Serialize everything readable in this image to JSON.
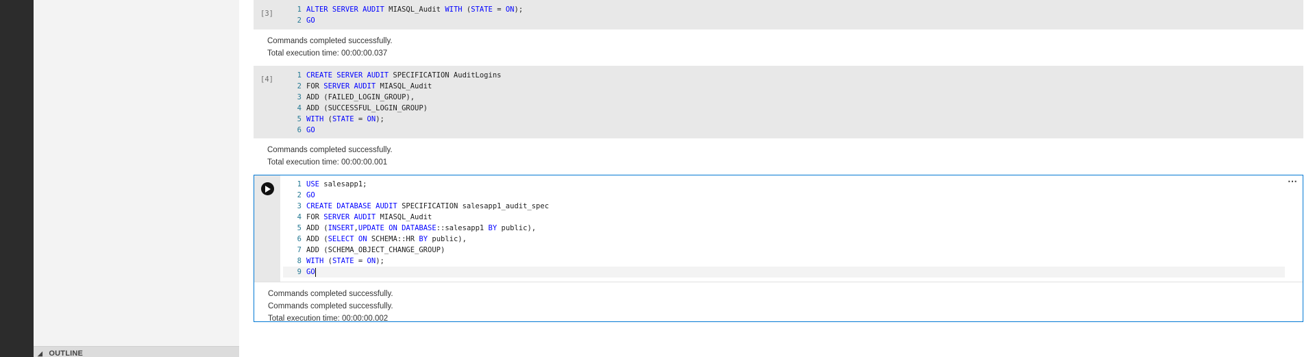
{
  "outline": {
    "label": "OUTLINE"
  },
  "cells": {
    "c3": {
      "exec_count": "[3]",
      "lines": [
        [
          {
            "t": "ALTER SERVER AUDIT",
            "k": true
          },
          {
            "t": " MIASQL_Audit ",
            "k": false
          },
          {
            "t": "WITH",
            "k": true
          },
          {
            "t": " (",
            "k": false
          },
          {
            "t": "STATE",
            "k": true
          },
          {
            "t": " = ",
            "k": false
          },
          {
            "t": "ON",
            "k": true
          },
          {
            "t": ");",
            "k": false
          }
        ],
        [
          {
            "t": "GO",
            "k": true
          }
        ]
      ],
      "output": [
        "Commands completed successfully.",
        "Total execution time: 00:00:00.037"
      ]
    },
    "c4": {
      "exec_count": "[4]",
      "lines": [
        [
          {
            "t": "CREATE SERVER AUDIT",
            "k": true
          },
          {
            "t": " SPECIFICATION AuditLogins",
            "k": false
          }
        ],
        [
          {
            "t": "FOR ",
            "k": false
          },
          {
            "t": "SERVER AUDIT",
            "k": true
          },
          {
            "t": " MIASQL_Audit",
            "k": false
          }
        ],
        [
          {
            "t": "ADD (FAILED_LOGIN_GROUP),",
            "k": false
          }
        ],
        [
          {
            "t": "ADD (SUCCESSFUL_LOGIN_GROUP)",
            "k": false
          }
        ],
        [
          {
            "t": "WITH",
            "k": true
          },
          {
            "t": " (",
            "k": false
          },
          {
            "t": "STATE",
            "k": true
          },
          {
            "t": " = ",
            "k": false
          },
          {
            "t": "ON",
            "k": true
          },
          {
            "t": ");",
            "k": false
          }
        ],
        [
          {
            "t": "GO",
            "k": true
          }
        ]
      ],
      "output": [
        "Commands completed successfully.",
        "Total execution time: 00:00:00.001"
      ]
    },
    "c5": {
      "lines": [
        [
          {
            "t": "USE",
            "k": true
          },
          {
            "t": " salesapp1;",
            "k": false
          }
        ],
        [
          {
            "t": "GO",
            "k": true
          }
        ],
        [
          {
            "t": "CREATE DATABASE AUDIT",
            "k": true
          },
          {
            "t": " SPECIFICATION salesapp1_audit_spec",
            "k": false
          }
        ],
        [
          {
            "t": "FOR ",
            "k": false
          },
          {
            "t": "SERVER AUDIT",
            "k": true
          },
          {
            "t": " MIASQL_Audit",
            "k": false
          }
        ],
        [
          {
            "t": "ADD (",
            "k": false
          },
          {
            "t": "INSERT",
            "k": true
          },
          {
            "t": ",",
            "k": false
          },
          {
            "t": "UPDATE",
            "k": true
          },
          {
            "t": " ",
            "k": false
          },
          {
            "t": "ON DATABASE",
            "k": true
          },
          {
            "t": "::salesapp1 ",
            "k": false
          },
          {
            "t": "BY",
            "k": true
          },
          {
            "t": " public),",
            "k": false
          }
        ],
        [
          {
            "t": "ADD (",
            "k": false
          },
          {
            "t": "SELECT",
            "k": true
          },
          {
            "t": " ",
            "k": false
          },
          {
            "t": "ON",
            "k": true
          },
          {
            "t": " SCHEMA::HR ",
            "k": false
          },
          {
            "t": "BY",
            "k": true
          },
          {
            "t": " public),",
            "k": false
          }
        ],
        [
          {
            "t": "ADD (SCHEMA_OBJECT_CHANGE_GROUP)",
            "k": false
          }
        ],
        [
          {
            "t": "WITH",
            "k": true
          },
          {
            "t": " (",
            "k": false
          },
          {
            "t": "STATE",
            "k": true
          },
          {
            "t": " = ",
            "k": false
          },
          {
            "t": "ON",
            "k": true
          },
          {
            "t": ");",
            "k": false
          }
        ],
        [
          {
            "t": "GO",
            "k": true
          }
        ]
      ],
      "output": [
        "Commands completed successfully.",
        "Commands completed successfully.",
        "Total execution time: 00:00:00.002"
      ]
    }
  },
  "colors": {
    "keyword": "#0000ff",
    "line_number": "#237893",
    "accent": "#0078d4"
  },
  "icons": {
    "run": "play-icon",
    "more": "more-actions-icon",
    "outline_chevron": "chevron-down-icon"
  }
}
